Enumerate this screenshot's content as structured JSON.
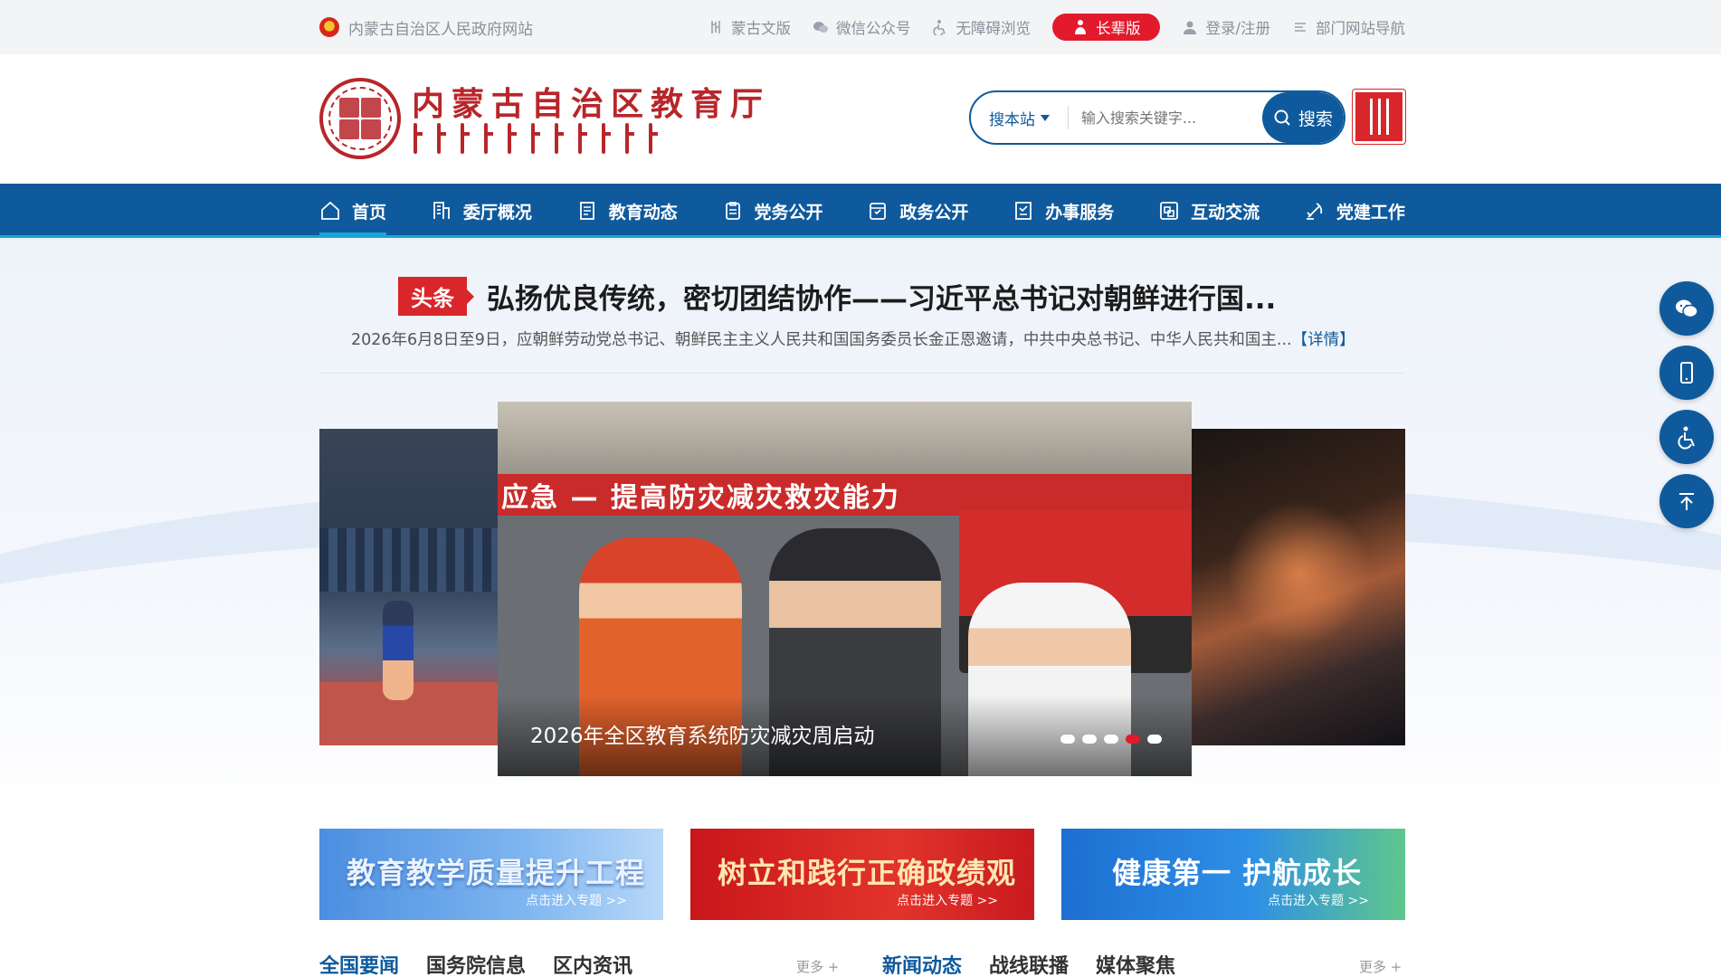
{
  "topbar": {
    "gov_site": "内蒙古自治区人民政府网站",
    "links": [
      "蒙古文版",
      "微信公众号",
      "无障碍浏览"
    ],
    "elder_label": "长辈版",
    "login_label": "登录/注册",
    "dept_nav_label": "部门网站导航"
  },
  "header": {
    "site_title": "内蒙古自治区教育厅",
    "search": {
      "scope_label": "搜本站",
      "placeholder": "输入搜索关键字...",
      "button_label": "搜索"
    }
  },
  "nav": {
    "items": [
      "首页",
      "委厅概况",
      "教育动态",
      "党务公开",
      "政务公开",
      "办事服务",
      "互动交流",
      "党建工作"
    ],
    "active_index": 0
  },
  "headline": {
    "tag": "头条",
    "title": "弘扬优良传统，密切团结协作——习近平总书记对朝鲜进行国...",
    "summary": "2026年6月8日至9日，应朝鲜劳动党总书记、朝鲜民主主义人民共和国国务委员长金正恩邀请，中共中央总书记、中华人民共和国主...",
    "detail_link": "【详情】"
  },
  "carousel": {
    "main_banner_text": "应急 — 提高防灾减灾救灾能力",
    "caption": "2026年全区教育系统防灾减灾周启动",
    "dot_count": 5,
    "active_dot": 3
  },
  "float_bar": [
    "wechat-icon",
    "mobile-icon",
    "accessibility-icon",
    "back-to-top-icon"
  ],
  "promos": [
    {
      "title": "教育教学质量提升工程",
      "sub": "点击进入专题 >>"
    },
    {
      "title": "树立和践行正确政绩观",
      "sub": "点击进入专题 >>"
    },
    {
      "title": "健康第一 护航成长",
      "sub": "点击进入专题 >>"
    }
  ],
  "news_left": {
    "tabs": [
      "全国要闻",
      "国务院信息",
      "区内资讯"
    ],
    "active": 0,
    "more": "更多 +"
  },
  "news_right": {
    "tabs": [
      "新闻动态",
      "战线联播",
      "媒体聚焦"
    ],
    "active": 0,
    "more": "更多 +"
  },
  "colors": {
    "primary": "#0f5a9c",
    "accent_red": "#e21a2c",
    "seal_red": "#b8262a"
  }
}
